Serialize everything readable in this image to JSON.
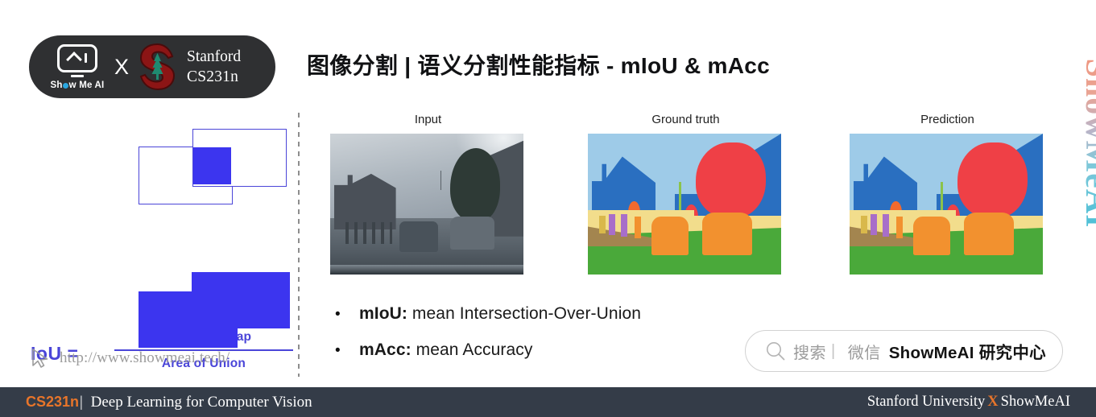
{
  "header": {
    "brand_logo": {
      "name": "ShowMeAI",
      "wordmark_pre": "Sh",
      "wordmark_post": "w Me AI"
    },
    "cross_symbol": "X",
    "partner": {
      "line1": "Stanford",
      "line2": "CS231n"
    }
  },
  "title": "图像分割 | 语义分割性能指标 - mIoU & mAcc",
  "iou_figure": {
    "equation_label": "IoU =",
    "numerator": "Area of Overlap",
    "denominator": "Area of Union"
  },
  "watermark": {
    "url": "http://www.showmeai.tech/",
    "cursor_icon": "cursor-arrow-icon"
  },
  "panels": [
    {
      "label": "Input",
      "kind": "photo"
    },
    {
      "label": "Ground truth",
      "kind": "segmentation"
    },
    {
      "label": "Prediction",
      "kind": "segmentation"
    }
  ],
  "bullets": [
    {
      "marker": "•",
      "term": "mIoU:",
      "definition": " mean Intersection-Over-Union"
    },
    {
      "marker": "•",
      "term": "mAcc:",
      "definition": " mean Accuracy"
    }
  ],
  "search_box": {
    "icon": "magnifier-icon",
    "label": "搜索",
    "separator": "|",
    "channel": "微信",
    "brand": "ShowMeAI 研究中心"
  },
  "vertical_brand": "ShowMeAI",
  "footer": {
    "course_code": "CS231n",
    "pipe": "|",
    "course_name": " Deep Learning for Computer Vision",
    "right_pre": "Stanford University",
    "right_x": "X",
    "right_post": "ShowMeAI"
  },
  "colors": {
    "accent_blue": "#4a45d8",
    "fill_blue": "#3c35ef",
    "footer_bg": "#343c48",
    "accent_orange": "#e8752a",
    "stanford_cardinal": "#8c1515",
    "seg_sky": "#9ecbe8",
    "seg_building": "#2a6fc0",
    "seg_tree": "#ef4046",
    "seg_car": "#f2912f",
    "seg_road": "#4aa93a",
    "seg_sidewalk": "#a3854f",
    "seg_fence": "#f2dd8c",
    "seg_person": "#a86ec9"
  }
}
